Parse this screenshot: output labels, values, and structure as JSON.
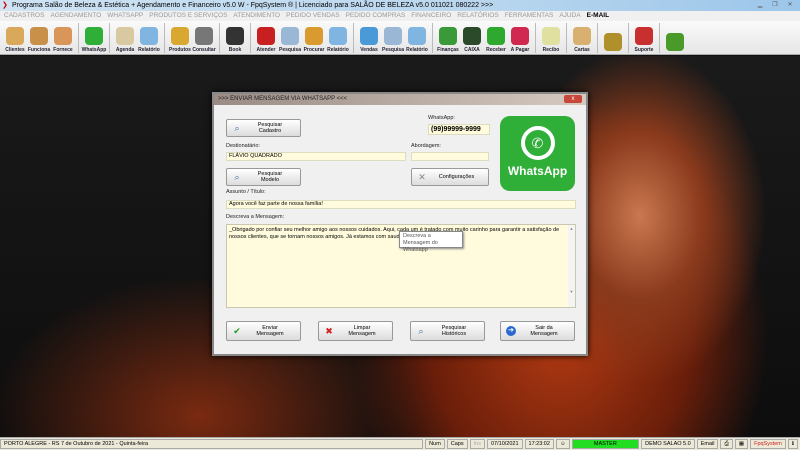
{
  "title": "Programa Salão de Beleza & Estética + Agendamento e Financeiro v5.0 W - FpqSystem ® | Licenciado para  SALÃO DE BELEZA v5.0 011021 080222 >>>",
  "menu": [
    "CADASTROS",
    "AGENDAMENTO",
    "WHATSAPP",
    "PRODUTOS E SERVIÇOS",
    "ATENDIMENTO",
    "PEDIDO VENDAS",
    "PEDIDO COMPRAS",
    "FINANCEIRO",
    "RELATÓRIOS",
    "FERRAMENTAS",
    "AJUDA"
  ],
  "menu_email": "E-MAIL",
  "toolbar": [
    {
      "label": "Clientes",
      "color": "#d9a85a"
    },
    {
      "label": "Funciona",
      "color": "#c9904a"
    },
    {
      "label": "Fornece",
      "color": "#d9955a"
    },
    {
      "sep": true
    },
    {
      "label": "WhatsApp",
      "color": "#2fae38"
    },
    {
      "sep": true
    },
    {
      "label": "Agenda",
      "color": "#d8c9a0"
    },
    {
      "label": "Relatório",
      "color": "#7fb5e0"
    },
    {
      "sep": true
    },
    {
      "label": "Produtos",
      "color": "#d9a830"
    },
    {
      "label": "Consultar",
      "color": "#777"
    },
    {
      "sep": true
    },
    {
      "label": "Book",
      "color": "#333"
    },
    {
      "sep": true
    },
    {
      "label": "Atender",
      "color": "#c82020"
    },
    {
      "label": "Pesquisa",
      "color": "#9ab7d6"
    },
    {
      "label": "Procurar",
      "color": "#d99a30"
    },
    {
      "label": "Relatório",
      "color": "#7fb5e0"
    },
    {
      "sep": true
    },
    {
      "label": "Vendas",
      "color": "#4a9ad8"
    },
    {
      "label": "Pesquisa",
      "color": "#9ab7d6"
    },
    {
      "label": "Relatório",
      "color": "#7fb5e0"
    },
    {
      "sep": true
    },
    {
      "label": "Finanças",
      "color": "#3a9a3a"
    },
    {
      "label": "CAIXA",
      "color": "#2a4a2a"
    },
    {
      "label": "Receber",
      "color": "#2ea82e"
    },
    {
      "label": "A Pagar",
      "color": "#d02850"
    },
    {
      "sep": true
    },
    {
      "label": "Recibo",
      "color": "#e0e0a0"
    },
    {
      "sep": true
    },
    {
      "label": "Cartas",
      "color": "#d9b070"
    },
    {
      "sep": true
    },
    {
      "label": "",
      "color": "#b0902a"
    },
    {
      "sep": true
    },
    {
      "label": "Suporte",
      "color": "#c83030"
    },
    {
      "sep": true
    },
    {
      "label": "",
      "color": "#4a9a2a"
    }
  ],
  "dialog": {
    "title": ">>> ENVIAR MENSAGEM VIA WHATSAPP  <<<",
    "close": "x",
    "whatsapp_label": "WhatsApp:",
    "whatsapp_value": "(99)99999-9999",
    "btn_pesquisar_cadastro": "Pesquisar Cadastro",
    "destinatario_label": "Destionatário:",
    "destinatario_value": "FLÁVIO QUADRADO",
    "abordagem_label": "Abordagem:",
    "abordagem_value": "",
    "btn_pesquisar_modelo": "Pesquisar Modelo",
    "btn_configuracoes": "Configurações",
    "assunto_label": "Assunto / Título:",
    "assunto_value": "Agora você faz parte de nossa família!",
    "mensagem_label": "Descreva a Mensagem:",
    "mensagem_value": "_Obrigado por confiar seu melhor amigo aos nossos cuidados. Aqui, cada um é tratado com muito carinho para garantir a satisfação de nossos clientes, que se tornam nossos amigos. Já estamos com saudades!_",
    "tooltip": "Descreva a Mensagem do Whatsapp",
    "logo_text": "WhatsApp",
    "btn_enviar": "Enviar Mensagem",
    "btn_limpar": "Limpar Mensagem",
    "btn_historicos": "Pesquisar Históricos",
    "btn_sair": "Sair da Mensagem"
  },
  "status": {
    "location": "PORTO ALEGRE - RS  7 de Outubro de 2021 - Quinta-feira",
    "num": "Num",
    "caps": "Caps",
    "ins": "Ins",
    "date": "07/10/2021",
    "time": "17:23:02",
    "user": "MASTER",
    "version": "DEMO SALAO 5.0",
    "email": "Email",
    "brand": "FpqSystem"
  },
  "colors": {
    "accent": "#2fae38",
    "user_badge": "#22dd22",
    "brand": "#cc2222"
  }
}
